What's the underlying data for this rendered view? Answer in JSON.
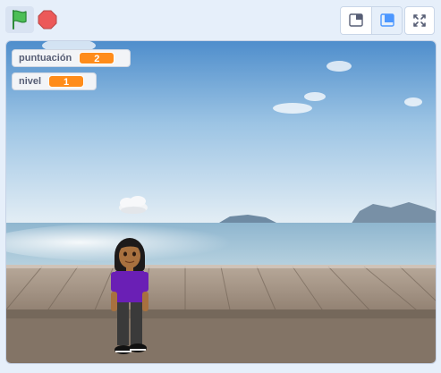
{
  "toolbar": {
    "green_flag_icon": "green-flag-icon",
    "stop_icon": "stop-icon",
    "small_stage_icon": "small-stage-icon",
    "normal_stage_icon": "normal-stage-icon",
    "fullscreen_icon": "fullscreen-icon"
  },
  "monitors": [
    {
      "label": "puntuación",
      "value": "2"
    },
    {
      "label": "nivel",
      "value": "1"
    }
  ],
  "colors": {
    "accent": "#4c97ff",
    "monitor_value": "#ff8c1a",
    "flag_green": "#4cbf56",
    "stop_red": "#ec5959"
  }
}
